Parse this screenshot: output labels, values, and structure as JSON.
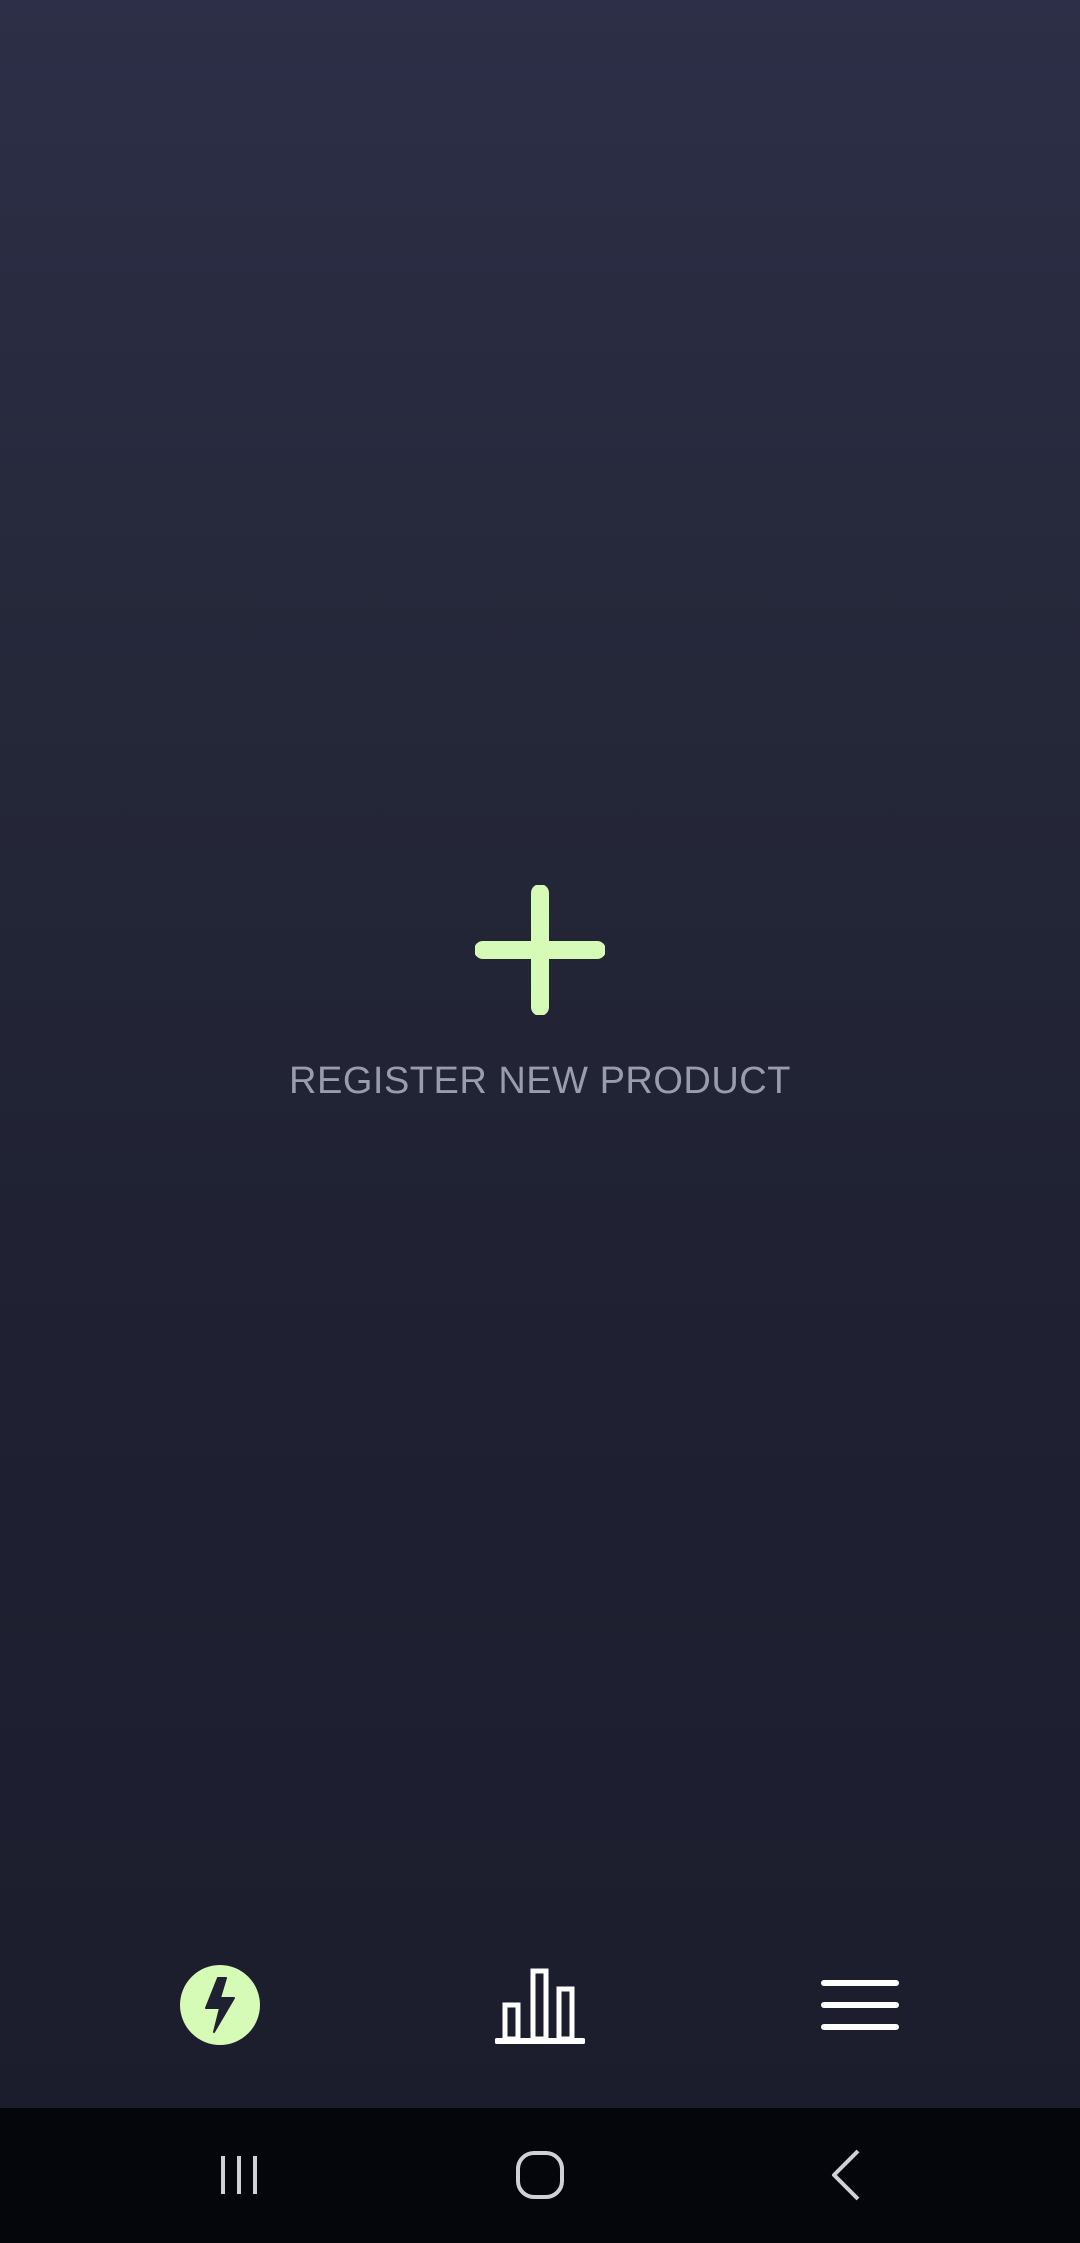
{
  "register": {
    "label": "REGISTER NEW PRODUCT",
    "icon": "plus-icon"
  },
  "bottom_nav": {
    "items": [
      {
        "icon": "bolt-icon",
        "active": true
      },
      {
        "icon": "bar-chart-icon",
        "active": false
      },
      {
        "icon": "hamburger-menu-icon",
        "active": false
      }
    ]
  },
  "system_nav": {
    "items": [
      {
        "icon": "recents-icon"
      },
      {
        "icon": "home-icon"
      },
      {
        "icon": "back-icon"
      }
    ]
  },
  "colors": {
    "accent": "#d6fbb6",
    "background_top": "#2c2f47",
    "background_bottom": "#1b1c2b",
    "label": "#9a9cab",
    "system_bar": "#05060c"
  }
}
